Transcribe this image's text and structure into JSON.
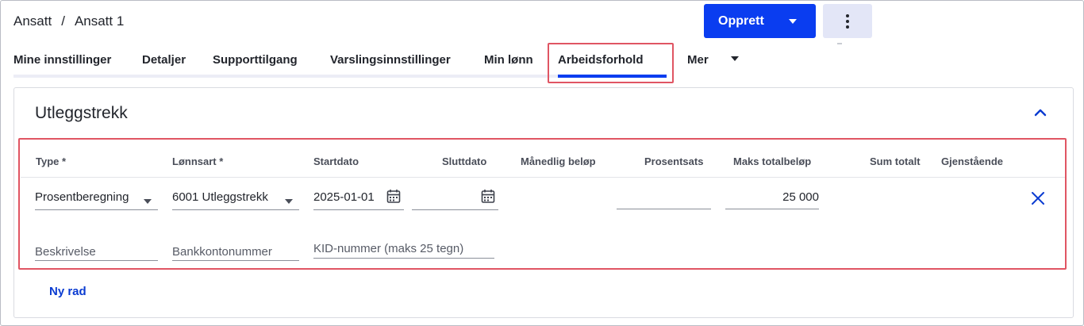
{
  "breadcrumb": {
    "parent": "Ansatt",
    "separator": "/",
    "current": "Ansatt 1"
  },
  "header": {
    "create_button": "Opprett",
    "create_caret_icon": "caret-down-icon",
    "more_icon": "vertical-dots-icon",
    "button_color": "#0a3df0"
  },
  "tabs": [
    {
      "label": "Mine innstillinger"
    },
    {
      "label": "Detaljer"
    },
    {
      "label": "Supporttilgang"
    },
    {
      "label": "Varslingsinnstillinger"
    },
    {
      "label": "Min lønn"
    },
    {
      "label": "Arbeidsforhold",
      "active": true
    },
    {
      "label": "Mer"
    }
  ],
  "section": {
    "title": "Utleggstrekk",
    "collapse_icon": "chevron-up-icon",
    "columns": {
      "type": "Type *",
      "lonnsart": "Lønnsart *",
      "startdato": "Startdato",
      "sluttdato": "Sluttdato",
      "manedlig": "Månedlig beløp",
      "prosentsats": "Prosentsats",
      "maks": "Maks totalbeløp",
      "sum": "Sum totalt",
      "gjenstaende": "Gjenstående"
    },
    "row": {
      "type": "Prosentberegning",
      "lonnsart": "6001 Utleggstrekk",
      "startdato": "2025-01-01",
      "sluttdato": "",
      "prosentsats": "",
      "maks": "25 000",
      "delete_icon": "close-icon",
      "calendar_icon": "calendar-icon"
    },
    "row2": {
      "beskrivelse_placeholder": "Beskrivelse",
      "bankkonto_placeholder": "Bankkontonummer",
      "kid_placeholder": "KID-nummer (maks 25 tegn)"
    },
    "new_row_label": "Ny rad"
  },
  "highlight_color": "#e05563"
}
